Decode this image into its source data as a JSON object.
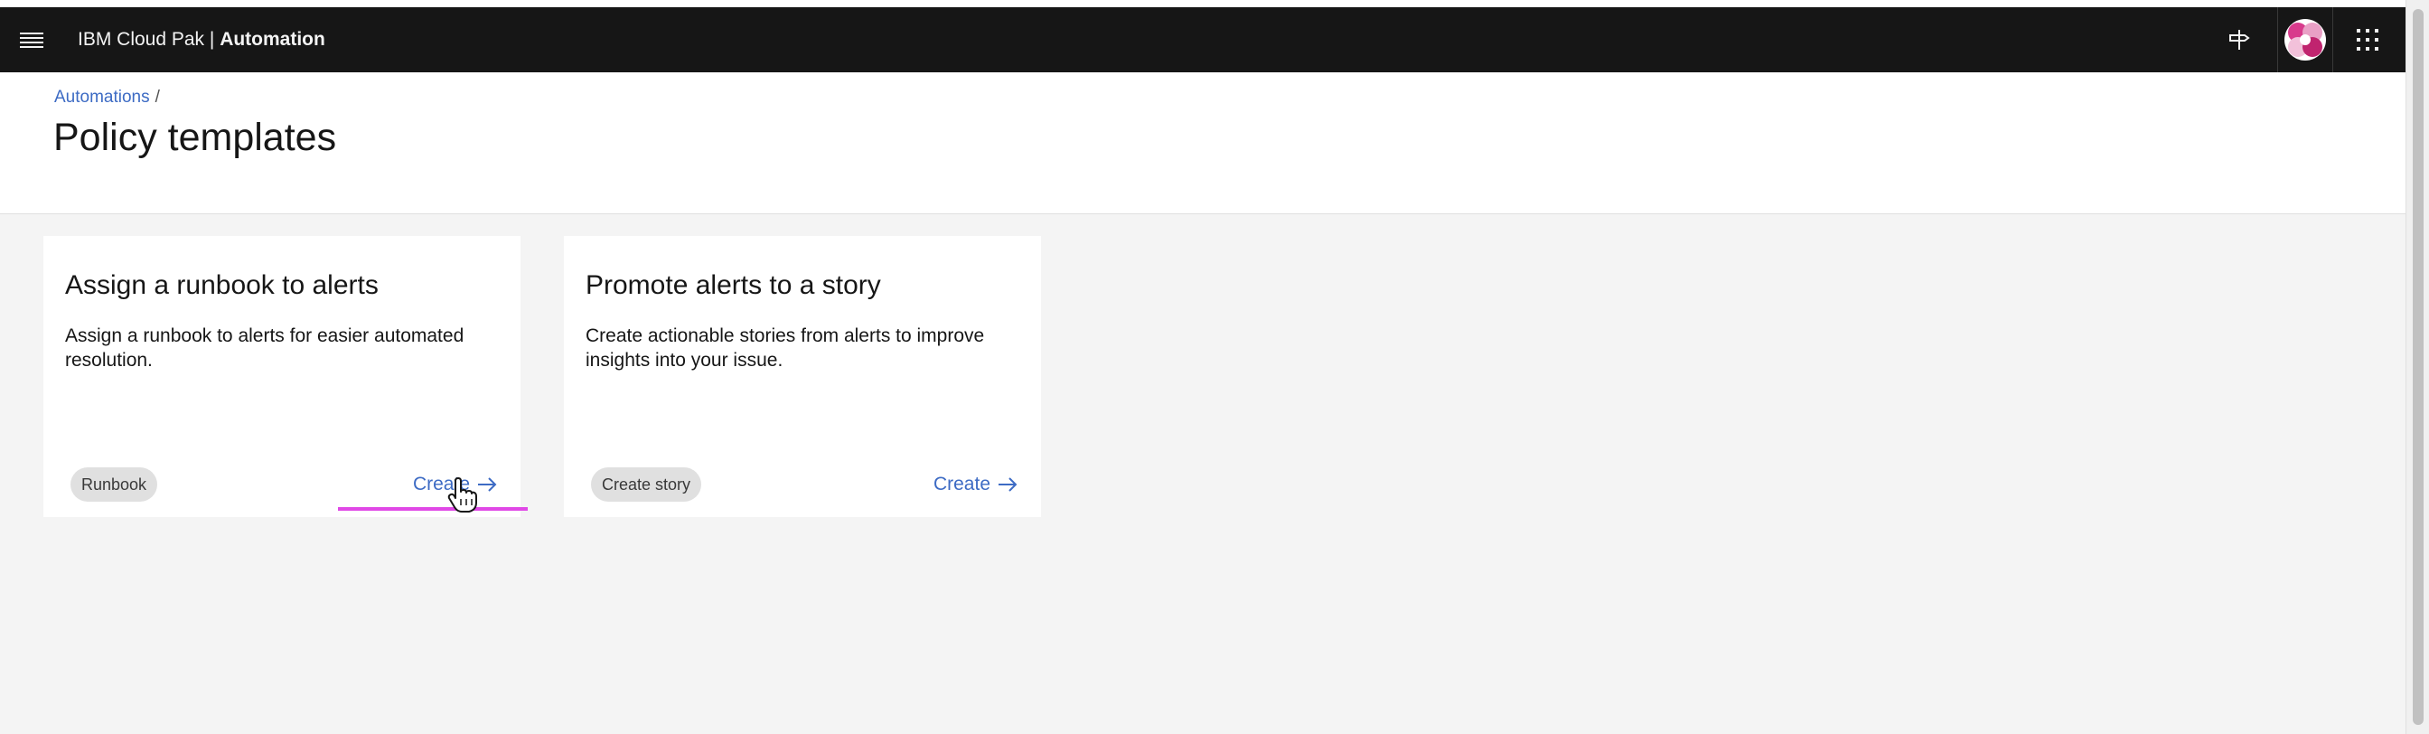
{
  "header": {
    "brand_prefix": "IBM Cloud Pak | ",
    "brand_product": "Automation",
    "icons": [
      "menu-icon",
      "signpost-icon",
      "avatar",
      "app-switcher-icon"
    ]
  },
  "breadcrumb": {
    "items": [
      {
        "label": "Automations"
      }
    ],
    "separator": "/"
  },
  "page": {
    "title": "Policy templates"
  },
  "cards": [
    {
      "title": "Assign a runbook to alerts",
      "description": "Assign a runbook to alerts for easier automated resolution.",
      "tag": "Runbook",
      "action_label": "Create"
    },
    {
      "title": "Promote alerts to a story",
      "description": "Create actionable stories from alerts to improve insights into your issue.",
      "tag": "Create story",
      "action_label": "Create"
    }
  ],
  "colors": {
    "header_bg": "#161616",
    "page_bg": "#f4f4f4",
    "link": "#3d6bc4",
    "tag_bg": "#e0e0e0",
    "highlight": "#e048e6"
  }
}
